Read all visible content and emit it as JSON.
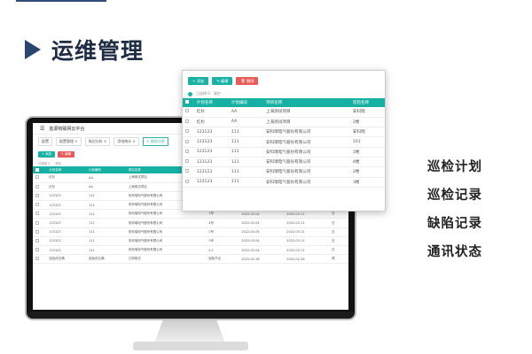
{
  "section": {
    "title": "运维管理"
  },
  "features": [
    "巡检计划",
    "巡检记录",
    "缺陷记录",
    "通讯状态"
  ],
  "app": {
    "title": "能源物联网云平台",
    "filters": [
      "配置",
      "配置管理 ×",
      "周边分析 ×",
      "用电统计 ×",
      "× 巡检计划"
    ],
    "buttons": {
      "add": "+ 添加",
      "edit": "✎ 编辑"
    },
    "info": [
      "已选择 0",
      "清空"
    ],
    "columns": [
      "",
      "计划名称",
      "计划编号",
      "项目名称",
      "巡检名称",
      "开始日期",
      "结束日期",
      "状态"
    ],
    "rows": [
      [
        "",
        "红杉",
        "AA",
        "上海测试项目",
        "",
        "",
        "",
        ""
      ],
      [
        "",
        "红杉",
        "AA",
        "上海测试项目",
        "",
        "",
        "",
        ""
      ],
      [
        "",
        "123123",
        "111",
        "安科瑞电气股份有限公司",
        "安科瑞",
        "2022-03-04",
        "2022-03-11",
        "日"
      ],
      [
        "",
        "123123",
        "111",
        "安科瑞电气股份有限公司",
        "101",
        "2022-03-04",
        "2022-03-11",
        "日"
      ],
      [
        "",
        "123123",
        "111",
        "安科瑞电气股份有限公司",
        "1号",
        "2022-03-04",
        "2022-03-11",
        "日"
      ],
      [
        "",
        "123123",
        "111",
        "安科瑞电气股份有限公司",
        "4号",
        "2022-03-04",
        "2022-03-11",
        "日"
      ],
      [
        "",
        "123123",
        "111",
        "安科瑞电气股份有限公司",
        "2号",
        "2022-03-04",
        "2022-03-11",
        "日"
      ],
      [
        "",
        "123123",
        "111",
        "安科瑞电气股份有限公司",
        "3号",
        "2022-03-04",
        "2022-03-11",
        "日"
      ],
      [
        "",
        "123123",
        "111",
        "安科瑞电气股份有限公司",
        "4-1",
        "2022-03-04",
        "2022-03-11",
        "日"
      ],
      [
        "",
        "巡检改正确",
        "巡检改正确",
        "江阴测试",
        "巡检节点",
        "2022-02-28",
        "2022-02-28",
        "周"
      ]
    ]
  },
  "popup": {
    "buttons": {
      "add": "+ 添加",
      "edit": "✎ 编辑",
      "delete": "🗑 删除"
    },
    "info": [
      "已选择 0",
      "清空"
    ],
    "columns": [
      "",
      "计划名称",
      "计划编号",
      "项目名称",
      "巡检名称"
    ],
    "rows": [
      [
        "",
        "红杉",
        "AA",
        "上海测试项目",
        "安科瑞"
      ],
      [
        "",
        "红杉",
        "AA",
        "上海测试项目",
        "2楼"
      ],
      [
        "",
        "123123",
        "111",
        "安科瑞电气股份有限公司",
        "安科瑞"
      ],
      [
        "",
        "123123",
        "111",
        "安科瑞电气股份有限公司",
        "101"
      ],
      [
        "",
        "123123",
        "111",
        "安科瑞电气股份有限公司",
        "1楼"
      ],
      [
        "",
        "123123",
        "111",
        "安科瑞电气股份有限公司",
        "4楼"
      ],
      [
        "",
        "123123",
        "111",
        "安科瑞电气股份有限公司",
        "2楼"
      ],
      [
        "",
        "123123",
        "111",
        "安科瑞电气股份有限公司",
        "3楼"
      ]
    ]
  },
  "colors": {
    "accent": "#17b1a3",
    "danger": "#e85c5c",
    "title": "#2a456e"
  }
}
